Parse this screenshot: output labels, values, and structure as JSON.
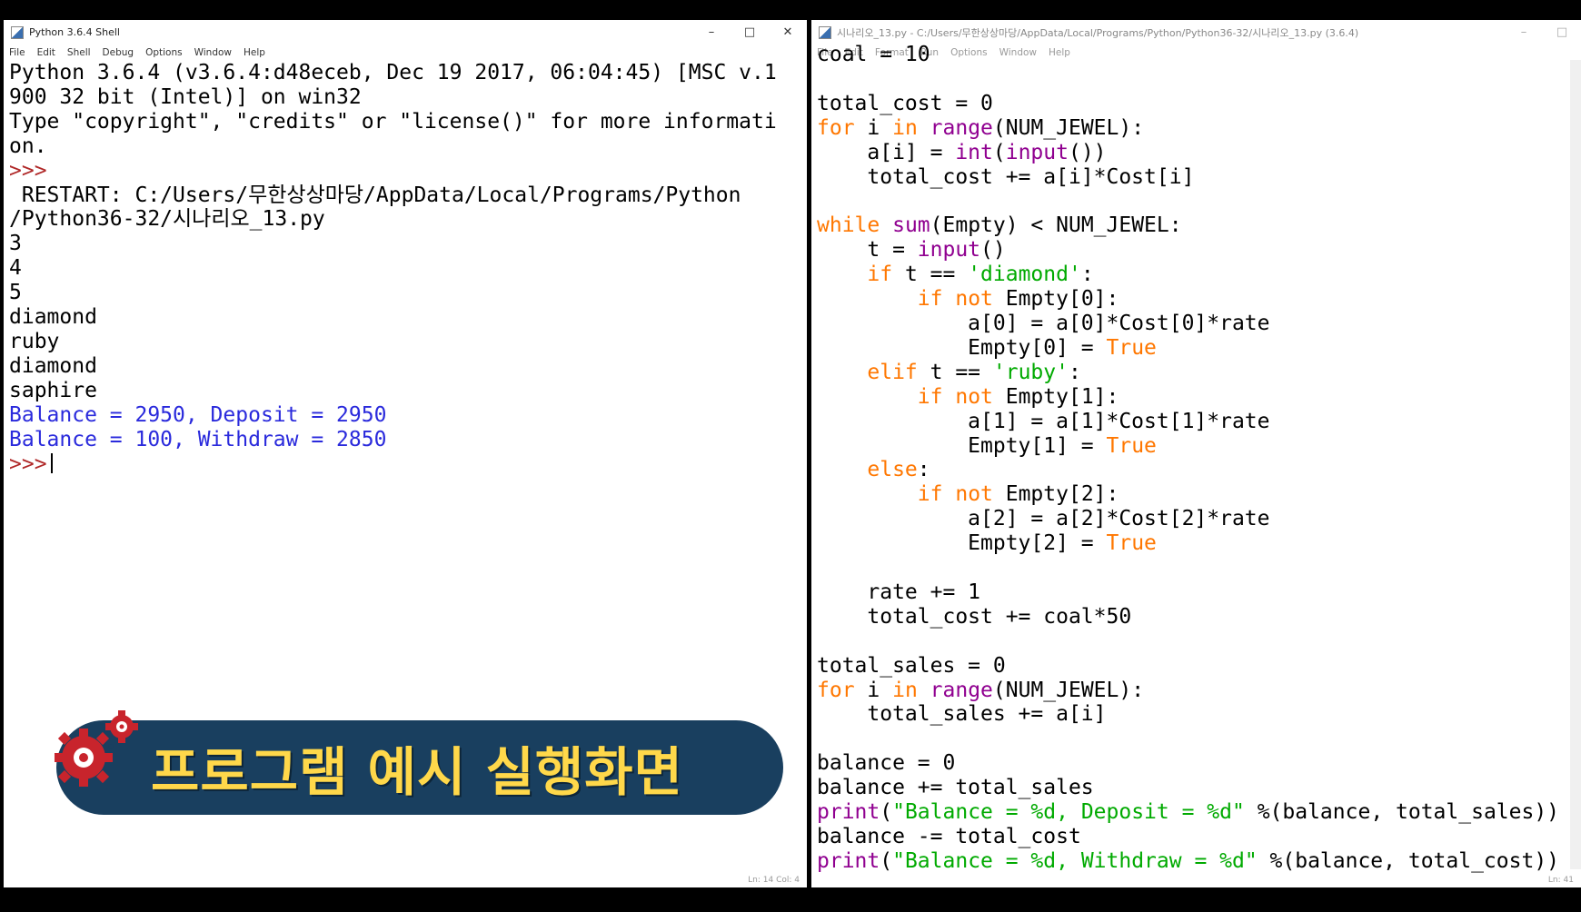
{
  "shell": {
    "title": "Python 3.6.4 Shell",
    "menu": [
      "File",
      "Edit",
      "Shell",
      "Debug",
      "Options",
      "Window",
      "Help"
    ],
    "lines": [
      {
        "text": "Python 3.6.4 (v3.6.4:d48eceb, Dec 19 2017, 06:04:45) [MSC v.1",
        "type": "plain"
      },
      {
        "text": "900 32 bit (Intel)] on win32",
        "type": "plain"
      },
      {
        "text": "Type \"copyright\", \"credits\" or \"license()\" for more informati",
        "type": "plain"
      },
      {
        "text": "on.",
        "type": "plain"
      },
      {
        "text": ">>>",
        "type": "prompt"
      },
      {
        "text": " RESTART: C:/Users/무한상상마당/AppData/Local/Programs/Python",
        "type": "plain"
      },
      {
        "text": "/Python36-32/시나리오_13.py",
        "type": "plain"
      },
      {
        "text": "3",
        "type": "plain"
      },
      {
        "text": "4",
        "type": "plain"
      },
      {
        "text": "5",
        "type": "plain"
      },
      {
        "text": "diamond",
        "type": "plain"
      },
      {
        "text": "ruby",
        "type": "plain"
      },
      {
        "text": "diamond",
        "type": "plain"
      },
      {
        "text": "saphire",
        "type": "plain"
      },
      {
        "text": "Balance = 2950, Deposit = 2950",
        "type": "out"
      },
      {
        "text": "Balance = 100, Withdraw = 2850",
        "type": "out"
      }
    ],
    "final_prompt": ">>>",
    "status": "Ln: 14  Col: 4"
  },
  "editor": {
    "title": "시나리오_13.py - C:/Users/무한상상마당/AppData/Local/Programs/Python/Python36-32/시나리오_13.py (3.6.4)",
    "menu": [
      "File",
      "Edit",
      "Format",
      "Run",
      "Options",
      "Window",
      "Help"
    ],
    "code_lines": [
      [
        [
          "coal = 10",
          "t"
        ]
      ],
      [
        [
          "",
          "t"
        ]
      ],
      [
        [
          "total_cost = 0",
          "t"
        ]
      ],
      [
        [
          "for",
          "kw"
        ],
        [
          " i ",
          "t"
        ],
        [
          "in",
          "kw"
        ],
        [
          " ",
          "t"
        ],
        [
          "range",
          "bi"
        ],
        [
          "(NUM_JEWEL):",
          "t"
        ]
      ],
      [
        [
          "    a[i] = ",
          "t"
        ],
        [
          "int",
          "bi"
        ],
        [
          "(",
          "t"
        ],
        [
          "input",
          "bi"
        ],
        [
          "())",
          "t"
        ]
      ],
      [
        [
          "    total_cost += a[i]*Cost[i]",
          "t"
        ]
      ],
      [
        [
          "",
          "t"
        ]
      ],
      [
        [
          "while",
          "kw"
        ],
        [
          " ",
          "t"
        ],
        [
          "sum",
          "bi"
        ],
        [
          "(Empty) < NUM_JEWEL:",
          "t"
        ]
      ],
      [
        [
          "    t = ",
          "t"
        ],
        [
          "input",
          "bi"
        ],
        [
          "()",
          "t"
        ]
      ],
      [
        [
          "    ",
          "t"
        ],
        [
          "if",
          "kw"
        ],
        [
          " t == ",
          "t"
        ],
        [
          "'diamond'",
          "str"
        ],
        [
          ":",
          "t"
        ]
      ],
      [
        [
          "        ",
          "t"
        ],
        [
          "if",
          "kw"
        ],
        [
          " ",
          "t"
        ],
        [
          "not",
          "kw"
        ],
        [
          " Empty[0]:",
          "t"
        ]
      ],
      [
        [
          "            a[0] = a[0]*Cost[0]*rate",
          "t"
        ]
      ],
      [
        [
          "            Empty[0] = ",
          "t"
        ],
        [
          "True",
          "kw"
        ]
      ],
      [
        [
          "    ",
          "t"
        ],
        [
          "elif",
          "kw"
        ],
        [
          " t == ",
          "t"
        ],
        [
          "'ruby'",
          "str"
        ],
        [
          ":",
          "t"
        ]
      ],
      [
        [
          "        ",
          "t"
        ],
        [
          "if",
          "kw"
        ],
        [
          " ",
          "t"
        ],
        [
          "not",
          "kw"
        ],
        [
          " Empty[1]:",
          "t"
        ]
      ],
      [
        [
          "            a[1] = a[1]*Cost[1]*rate",
          "t"
        ]
      ],
      [
        [
          "            Empty[1] = ",
          "t"
        ],
        [
          "True",
          "kw"
        ]
      ],
      [
        [
          "    ",
          "t"
        ],
        [
          "else",
          "kw"
        ],
        [
          ":",
          "t"
        ]
      ],
      [
        [
          "        ",
          "t"
        ],
        [
          "if",
          "kw"
        ],
        [
          " ",
          "t"
        ],
        [
          "not",
          "kw"
        ],
        [
          " Empty[2]:",
          "t"
        ]
      ],
      [
        [
          "            a[2] = a[2]*Cost[2]*rate",
          "t"
        ]
      ],
      [
        [
          "            Empty[2] = ",
          "t"
        ],
        [
          "True",
          "kw"
        ]
      ],
      [
        [
          "",
          "t"
        ]
      ],
      [
        [
          "    rate += 1",
          "t"
        ]
      ],
      [
        [
          "    total_cost += coal*50",
          "t"
        ]
      ],
      [
        [
          "",
          "t"
        ]
      ],
      [
        [
          "total_sales = 0",
          "t"
        ]
      ],
      [
        [
          "for",
          "kw"
        ],
        [
          " i ",
          "t"
        ],
        [
          "in",
          "kw"
        ],
        [
          " ",
          "t"
        ],
        [
          "range",
          "bi"
        ],
        [
          "(NUM_JEWEL):",
          "t"
        ]
      ],
      [
        [
          "    total_sales += a[i]",
          "t"
        ]
      ],
      [
        [
          "",
          "t"
        ]
      ],
      [
        [
          "balance = 0",
          "t"
        ]
      ],
      [
        [
          "balance += total_sales",
          "t"
        ]
      ],
      [
        [
          "print",
          "bi"
        ],
        [
          "(",
          "t"
        ],
        [
          "\"Balance = %d, Deposit = %d\"",
          "str"
        ],
        [
          " %(balance, total_sales))",
          "t"
        ]
      ],
      [
        [
          "balance -= total_cost",
          "t"
        ]
      ],
      [
        [
          "print",
          "bi"
        ],
        [
          "(",
          "t"
        ],
        [
          "\"Balance = %d, Withdraw = %d\"",
          "str"
        ],
        [
          " %(balance, total_cost))",
          "t"
        ]
      ]
    ],
    "status": "Ln: 41"
  },
  "banner": {
    "text": "프로그램 예시 실행화면"
  },
  "colors": {
    "keyword": "#ff7700",
    "builtin": "#900090",
    "string": "#00aa00",
    "output": "#2a2adc",
    "prompt": "#b02828",
    "banner_bg": "#193f5f",
    "banner_text": "#ffd84a"
  }
}
